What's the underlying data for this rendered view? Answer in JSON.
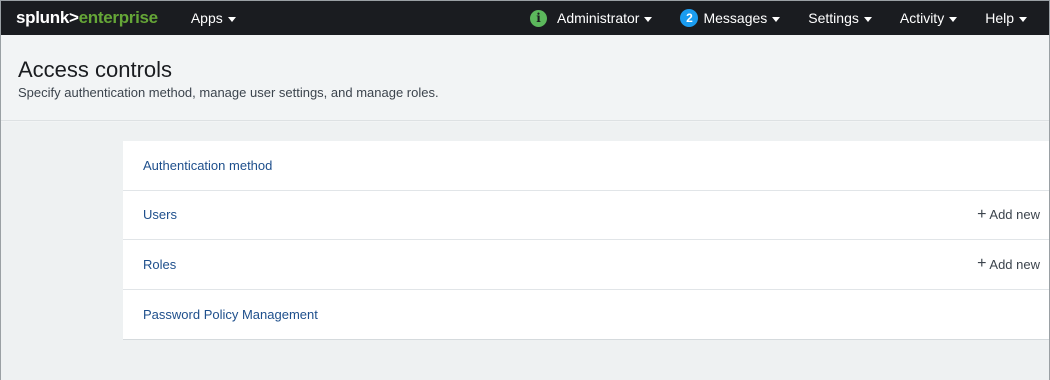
{
  "header": {
    "logo_part1": "splunk>",
    "logo_part2": "enterprise",
    "apps_label": "Apps",
    "info_icon_glyph": "i",
    "admin_label": "Administrator",
    "messages_count": "2",
    "messages_label": "Messages",
    "settings_label": "Settings",
    "activity_label": "Activity",
    "help_label": "Help"
  },
  "page": {
    "title": "Access controls",
    "subtitle": "Specify authentication method, manage user settings, and manage roles."
  },
  "items": [
    {
      "label": "Authentication method",
      "action": ""
    },
    {
      "label": "Users",
      "action": "Add new"
    },
    {
      "label": "Roles",
      "action": "Add new"
    },
    {
      "label": "Password Policy Management",
      "action": ""
    }
  ],
  "icons": {
    "plus": "plus-icon",
    "caret": "chevron-down-icon",
    "info": "info-icon"
  },
  "colors": {
    "topbar": "#1a1c20",
    "brand_green": "#65a637",
    "info_green": "#5cb85c",
    "messages_blue": "#1a9cf0",
    "link_blue": "#1e4f8c"
  }
}
